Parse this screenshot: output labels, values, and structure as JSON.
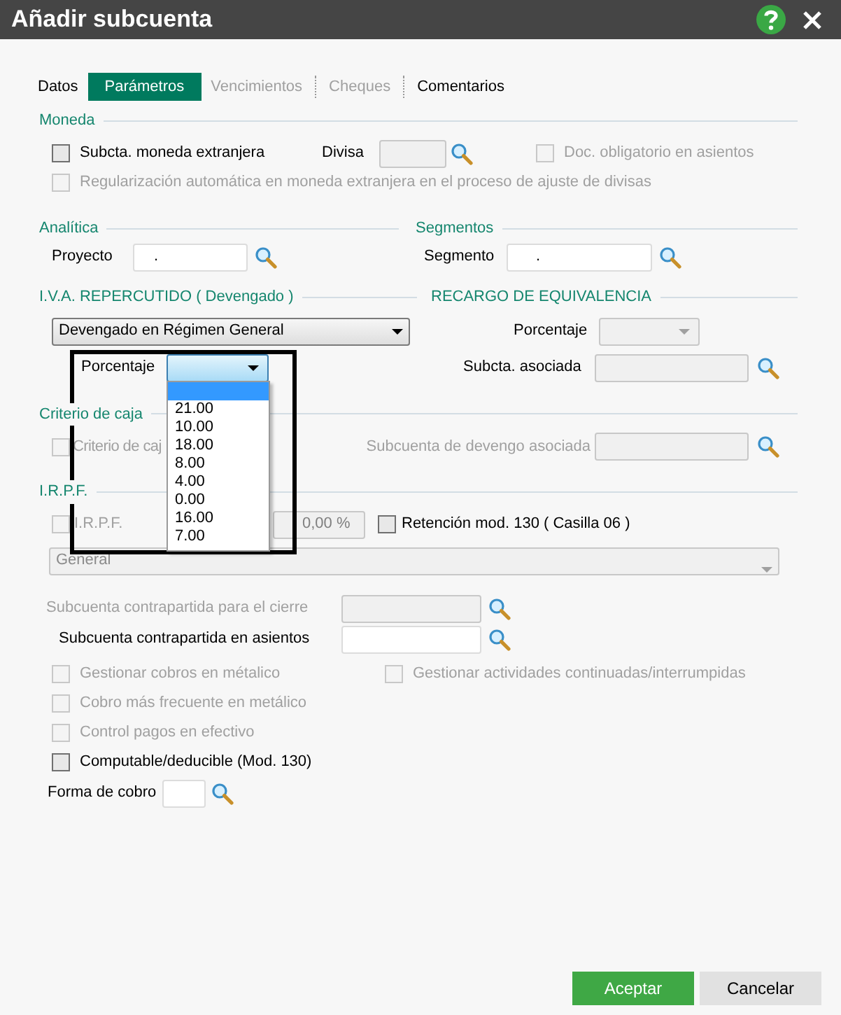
{
  "window": {
    "title": "Añadir subcuenta"
  },
  "tabs": [
    {
      "label": "Datos",
      "selected": false,
      "disabled": false
    },
    {
      "label": "Parámetros",
      "selected": true,
      "disabled": false
    },
    {
      "label": "Vencimientos",
      "selected": false,
      "disabled": true
    },
    {
      "label": "Cheques",
      "selected": false,
      "disabled": true
    },
    {
      "label": "Comentarios",
      "selected": false,
      "disabled": false
    }
  ],
  "moneda": {
    "title": "Moneda",
    "subcta_extranjera": {
      "label": "Subcta. moneda extranjera",
      "checked": false,
      "disabled": false
    },
    "divisa": {
      "label": "Divisa",
      "disabled": true
    },
    "doc_obligatorio": {
      "label": "Doc. obligatorio en asientos",
      "checked": false,
      "disabled": true
    },
    "regularizacion": {
      "label": "Regularización automática en moneda extranjera en el proceso de ajuste de divisas",
      "checked": false,
      "disabled": true
    }
  },
  "analitica": {
    "title": "Analítica",
    "proyecto": {
      "label": "Proyecto",
      "value": "."
    }
  },
  "segmentos": {
    "title": "Segmentos",
    "segmento": {
      "label": "Segmento",
      "value": "."
    }
  },
  "iva": {
    "title": "I.V.A. REPERCUTIDO ( Devengado )",
    "regimen": {
      "value": "Devengado en Régimen General"
    },
    "porcentaje": {
      "label": "Porcentaje",
      "open": true,
      "blank_option_highlighted": true,
      "options": [
        {
          "label": "21.00",
          "selected": false
        },
        {
          "label": "10.00",
          "selected": false
        },
        {
          "label": "18.00",
          "selected": false
        },
        {
          "label": "8.00",
          "selected": false
        },
        {
          "label": "4.00",
          "selected": false
        },
        {
          "label": "0.00",
          "selected": false
        },
        {
          "label": "16.00",
          "selected": false
        },
        {
          "label": "7.00",
          "selected": false
        }
      ]
    }
  },
  "recargo": {
    "title": "RECARGO DE EQUIVALENCIA",
    "porcentaje": {
      "label": "Porcentaje",
      "disabled": true
    },
    "subcta_asociada": {
      "label": "Subcta. asociada",
      "disabled": true
    }
  },
  "criterio_caja": {
    "title": "Criterio de caja",
    "checkbox": {
      "label": "Criterio de caj",
      "checked": false,
      "disabled": true
    },
    "subcuenta_devengo": {
      "label": "Subcuenta de devengo asociada",
      "disabled": true
    }
  },
  "irpf": {
    "title": "I.R.P.F.",
    "checkbox": {
      "label": "I.R.P.F.",
      "checked": false,
      "disabled": true
    },
    "value": "0,00 %",
    "retencion": {
      "label": "Retención mod. 130 ( Casilla 06 )",
      "checked": false,
      "disabled": false
    },
    "tipo": {
      "value": "General",
      "disabled": true
    }
  },
  "contrapartida_cierre": {
    "label": "Subcuenta contrapartida para el cierre",
    "disabled": true
  },
  "contrapartida_asientos": {
    "label": "Subcuenta contrapartida en asientos",
    "disabled": false
  },
  "checkbox_rows": [
    [
      {
        "label": "Gestionar cobros en métalico",
        "checked": false,
        "disabled": true
      },
      {
        "label": "Gestionar actividades continuadas/interrumpidas",
        "checked": false,
        "disabled": true
      }
    ],
    [
      {
        "label": "Cobro más frecuente en metálico",
        "checked": false,
        "disabled": true
      }
    ],
    [
      {
        "label": "Control pagos en efectivo",
        "checked": false,
        "disabled": true
      }
    ],
    [
      {
        "label": "Computable/deducible (Mod. 130)",
        "checked": false,
        "disabled": false
      }
    ]
  ],
  "forma_cobro": {
    "label": "Forma de cobro"
  },
  "buttons": [
    {
      "label": "Aceptar",
      "kind": "primary"
    },
    {
      "label": "Cancelar",
      "kind": "secondary"
    }
  ]
}
